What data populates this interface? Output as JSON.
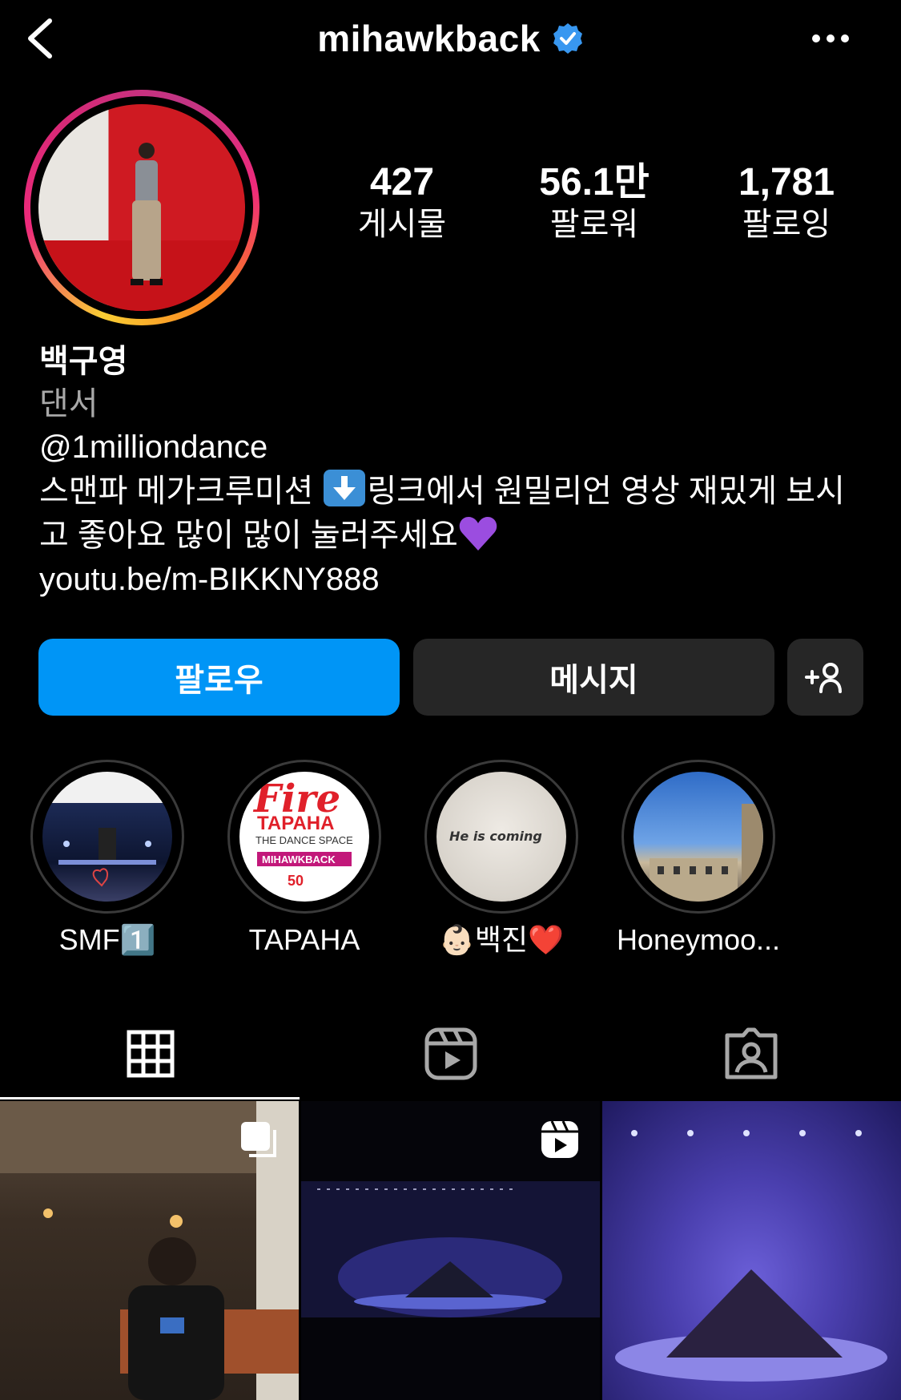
{
  "header": {
    "username": "mihawkback",
    "verified": true,
    "icons": {
      "back": "chevron-left-icon",
      "verified": "verified-badge-icon",
      "more": "more-horizontal-icon"
    }
  },
  "stats": [
    {
      "value": "427",
      "label": "게시물"
    },
    {
      "value": "56.1만",
      "label": "팔로워"
    },
    {
      "value": "1,781",
      "label": "팔로잉"
    }
  ],
  "bio": {
    "name": "백구영",
    "category": "댄서",
    "mention": "@1milliondance",
    "text_line1_a": "스맨파 메가크루미션 ",
    "text_line1_b": "링크에서 원밀리언 영상 재밌게 보시",
    "text_line2": "고 좋아요 많이 많이 눌러주세요",
    "link": "youtu.be/m-BIKKNY888"
  },
  "buttons": {
    "follow": "팔로우",
    "message": "메시지",
    "add_user_icon": "add-user-icon"
  },
  "highlights": [
    {
      "label": "SMF1️⃣"
    },
    {
      "label": "TAPAHA"
    },
    {
      "label": "👶🏻백진❤️"
    },
    {
      "label": "Honeymoo..."
    }
  ],
  "highlight_texts": {
    "tapaha_fire": "Fire",
    "tapaha_line1": "TAPAHA",
    "tapaha_line2": "THE DANCE SPACE",
    "tapaha_line3": "MIHAWKBACK",
    "tapaha_line4": "50",
    "baekjin": "He is coming"
  },
  "tabs": [
    {
      "name": "grid",
      "icon": "grid-icon",
      "active": true
    },
    {
      "name": "reels",
      "icon": "reels-icon",
      "active": false
    },
    {
      "name": "tagged",
      "icon": "tagged-user-icon",
      "active": false
    }
  ],
  "colors": {
    "follow_button": "#0095f6",
    "secondary_button": "#262626",
    "verified": "#3897f0",
    "muted_text": "#a8a8a8"
  }
}
